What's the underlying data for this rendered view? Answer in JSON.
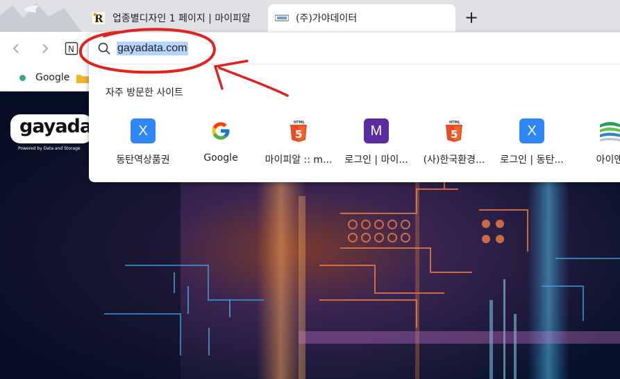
{
  "tabs": [
    {
      "title": "업종별디자인 1 페이지 | 마이피알",
      "favicon": "pr-logo-icon"
    },
    {
      "title": "(주)가야데이터",
      "favicon": "gaya-favicon-icon",
      "active": true
    }
  ],
  "new_tab_label": "+",
  "toolbar": {
    "back": "back-arrow-icon",
    "forward": "forward-arrow-icon",
    "extension": "N"
  },
  "bookmarks": {
    "items": [
      {
        "label": "Google"
      }
    ]
  },
  "omnibox": {
    "value": "gayadata.com",
    "section_title": "자주 방문한 사이트",
    "shortcuts": [
      {
        "label": "동탄역상품권",
        "icon": "X",
        "type": "x"
      },
      {
        "label": "Google",
        "icon": "google-icon",
        "type": "google"
      },
      {
        "label": "마이피알 :: m...",
        "icon": "html5-icon",
        "type": "html5"
      },
      {
        "label": "로그인 | 마이...",
        "icon": "M",
        "type": "m"
      },
      {
        "label": "(사)한국환경...",
        "icon": "html5-icon",
        "type": "html5"
      },
      {
        "label": "로그인 | 동탄...",
        "icon": "X",
        "type": "x"
      },
      {
        "label": "아이앤",
        "icon": "stripes-icon",
        "type": "stripes"
      }
    ]
  },
  "hero": {
    "logo_text": "gayada",
    "logo_tagline": "Powered by Data and Storage"
  },
  "colors": {
    "tab_strip": "#dfe1e5",
    "selection": "#b4d5fe",
    "annotation_red": "#e0231b",
    "x_tile": "#2f86f6",
    "m_tile": "#5b2c9f"
  }
}
